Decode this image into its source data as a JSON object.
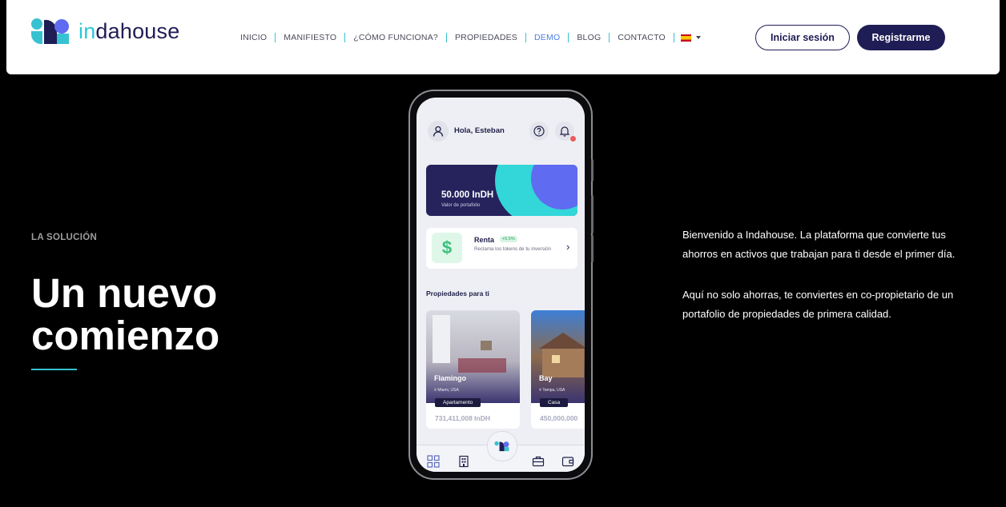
{
  "header": {
    "logo_text_a": "in",
    "logo_text_b": "dahouse",
    "nav": [
      {
        "label": "INICIO"
      },
      {
        "label": "MANIFIESTO"
      },
      {
        "label": "¿CÓMO FUNCIONA?"
      },
      {
        "label": "PROPIEDADES"
      },
      {
        "label": "DEMO",
        "active": true
      },
      {
        "label": "BLOG"
      },
      {
        "label": "CONTACTO"
      }
    ],
    "login_label": "Iniciar sesión",
    "register_label": "Registrarme"
  },
  "hero": {
    "eyebrow": "LA SOLUCIÓN",
    "title_line1": "Un nuevo",
    "title_line2": "comienzo"
  },
  "copy": {
    "p1": "Bienvenido a Indahouse. La plataforma que convierte tus ahorros en activos que trabajan para ti desde el primer día.",
    "p2": "Aquí no solo ahorras, te conviertes en co-propietario de un portafolio de propiedades de primera calidad."
  },
  "app": {
    "greeting": "Hola, Esteban",
    "portfolio_value": "50.000 InDH",
    "portfolio_label": "Valor de portafolio",
    "renta_title": "Renta",
    "renta_badge": "+5.5%",
    "renta_desc": "Reclama los tokens de tu inversión",
    "props_heading": "Propiedades para ti",
    "properties": [
      {
        "name": "Flamingo",
        "location": "Miami, USA",
        "tag": "Apartamento",
        "price": "731,411,008 InDH"
      },
      {
        "name": "Bay",
        "location": "Tampa, USA",
        "tag": "Casa",
        "price": "450,000,000"
      }
    ]
  },
  "colors": {
    "brand_navy": "#1f1d55",
    "brand_cyan": "#37c2d1",
    "active_nav": "#4a7ee8"
  }
}
